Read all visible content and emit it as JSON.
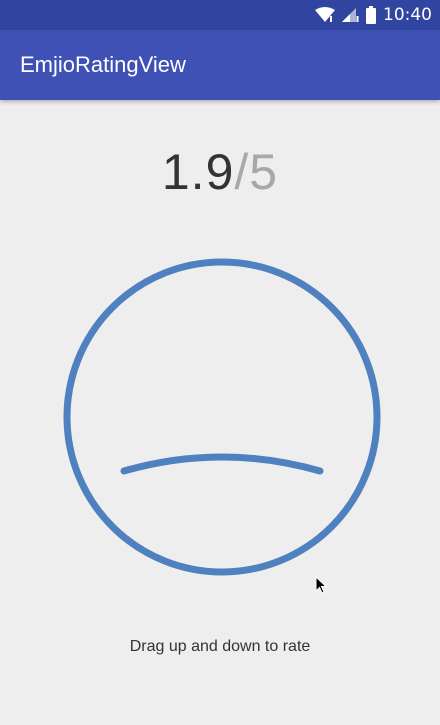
{
  "status_bar": {
    "time": "10:40",
    "icons": [
      "wifi-icon",
      "signal-icon",
      "battery-icon"
    ]
  },
  "app_bar": {
    "title": "EmjioRatingView"
  },
  "rating": {
    "value": "1.9",
    "separator": "/",
    "max": "5"
  },
  "face": {
    "rating_fraction": 0.38,
    "stroke_color": "#4f81c0"
  },
  "instruction": "Drag up and down to rate",
  "colors": {
    "status_bar": "#3045a0",
    "app_bar": "#3f51b5",
    "background": "#eeeeee",
    "face": "#4f81c0"
  }
}
